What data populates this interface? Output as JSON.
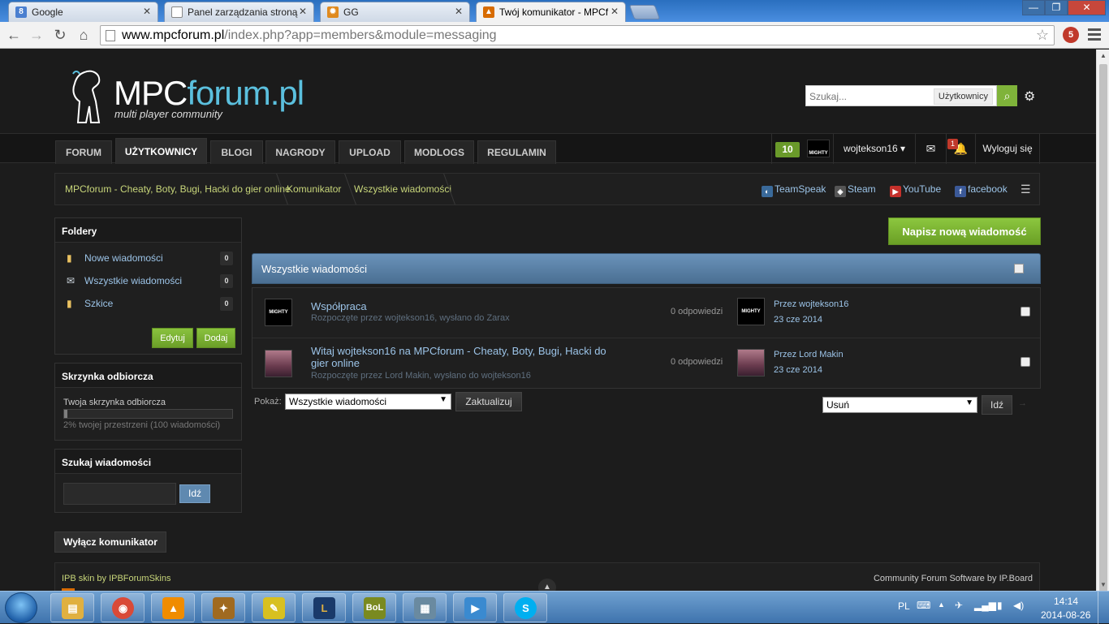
{
  "browser": {
    "tabs": [
      {
        "title": "Google",
        "icon": "google-icon",
        "color": "#4a7fd0",
        "glyph": "8"
      },
      {
        "title": "Panel zarządzania stroną",
        "icon": "page-icon",
        "color": "#8a8a8a",
        "glyph": ""
      },
      {
        "title": "GG",
        "icon": "gg-sun-icon",
        "color": "#e08a1e",
        "glyph": "✹"
      },
      {
        "title": "Twój komunikator - MPCf",
        "icon": "mpc-icon",
        "color": "#d76b00",
        "glyph": "▲"
      }
    ],
    "url_host": "www.mpcforum.pl",
    "url_path": "/index.php?app=members&module=messaging",
    "extension_badge": "5"
  },
  "header": {
    "logo_main": "MPC",
    "logo_accent": "forum.pl",
    "logo_tagline": "multi player community",
    "search_placeholder": "Szukaj...",
    "search_scope": "Użytkownicy"
  },
  "nav": {
    "tabs": [
      "Forum",
      "Użytkownicy",
      "Blogi",
      "Nagrody",
      "Upload",
      "Modlogs",
      "Regulamin"
    ],
    "active": "Użytkownicy",
    "reputation": "10",
    "username": "wojtekson16",
    "notifications_count": "1",
    "logout": "Wyloguj się"
  },
  "breadcrumb": {
    "items": [
      "MPCforum - Cheaty, Boty, Bugi, Hacki do gier online",
      "Komunikator",
      "Wszystkie wiadomości"
    ],
    "social": [
      {
        "label": "TeamSpeak",
        "icon": "teamspeak-icon",
        "color": "#3a6a9a"
      },
      {
        "label": "Steam",
        "icon": "steam-icon",
        "color": "#555555"
      },
      {
        "label": "YouTube",
        "icon": "youtube-icon",
        "color": "#c4302b"
      },
      {
        "label": "facebook",
        "icon": "facebook-icon",
        "color": "#3b5998"
      }
    ]
  },
  "sidebar": {
    "folders_title": "Foldery",
    "folders": [
      {
        "label": "Nowe wiadomości",
        "count": "0",
        "icon": "new-folder-icon"
      },
      {
        "label": "Wszystkie wiadomości",
        "count": "0",
        "icon": "envelope-icon"
      },
      {
        "label": "Szkice",
        "count": "0",
        "icon": "draft-folder-icon"
      }
    ],
    "edit_label": "Edytuj",
    "add_label": "Dodaj",
    "inbox_title": "Skrzynka odbiorcza",
    "inbox_label": "Twoja skrzynka odbiorcza",
    "inbox_usage_percent": 2,
    "inbox_usage_text": "2% twojej przestrzeni (100 wiadomości)",
    "search_title": "Szukaj wiadomości",
    "search_go": "Idź"
  },
  "main": {
    "compose_label": "Napisz nową wiadomość",
    "list_title": "Wszystkie wiadomości",
    "messages": [
      {
        "title": "Współpraca",
        "title_line2": "",
        "meta": "Rozpoczęte przez wojtekson16, wysłano do Zarax",
        "replies": "0 odpowiedzi",
        "last_by": "Przez wojtekson16",
        "last_date": "23 cze 2014",
        "avatar_label": "MIGHTY SERVICE"
      },
      {
        "title": "Witaj wojtekson16 na MPCforum - Cheaty, Boty, Bugi, Hacki do",
        "title_line2": "gier online",
        "meta": "Rozpoczęte przez Lord Makin, wysłano do wojtekson16",
        "replies": "0 odpowiedzi",
        "last_by": "Przez Lord Makin",
        "last_date": "23 cze 2014",
        "avatar_label": ""
      }
    ],
    "show_label": "Pokaż:",
    "show_value": "Wszystkie wiadomości",
    "update_label": "Zaktualizuj",
    "action_value": "Usuń",
    "action_go": "Idź"
  },
  "footer": {
    "disable_label": "Wyłącz komunikator",
    "skin_credit": "IPB skin by IPBForumSkins",
    "software_credit": "Community Forum Software by IP.Board"
  },
  "taskbar": {
    "apps": [
      {
        "name": "explorer-icon",
        "color": "#e0b040",
        "glyph": "▤"
      },
      {
        "name": "chrome-icon",
        "color": "#d94a38",
        "glyph": "◉"
      },
      {
        "name": "avast-icon",
        "color": "#f08c00",
        "glyph": "▲"
      },
      {
        "name": "hearthstone-icon",
        "color": "#a06a20",
        "glyph": "✦"
      },
      {
        "name": "idea-icon",
        "color": "#d8c020",
        "glyph": "✎"
      },
      {
        "name": "league-icon",
        "color": "#1a3a6a",
        "glyph": "L"
      },
      {
        "name": "bol-icon",
        "color": "#7a8a20",
        "glyph": "BoL"
      },
      {
        "name": "calculator-icon",
        "color": "#6a8aa0",
        "glyph": "▦"
      },
      {
        "name": "media-player-icon",
        "color": "#3a8ad0",
        "glyph": "▶"
      },
      {
        "name": "skype-icon",
        "color": "#00aff0",
        "glyph": "S"
      }
    ],
    "language": "PL",
    "time": "14:14",
    "date": "2014-08-26"
  }
}
